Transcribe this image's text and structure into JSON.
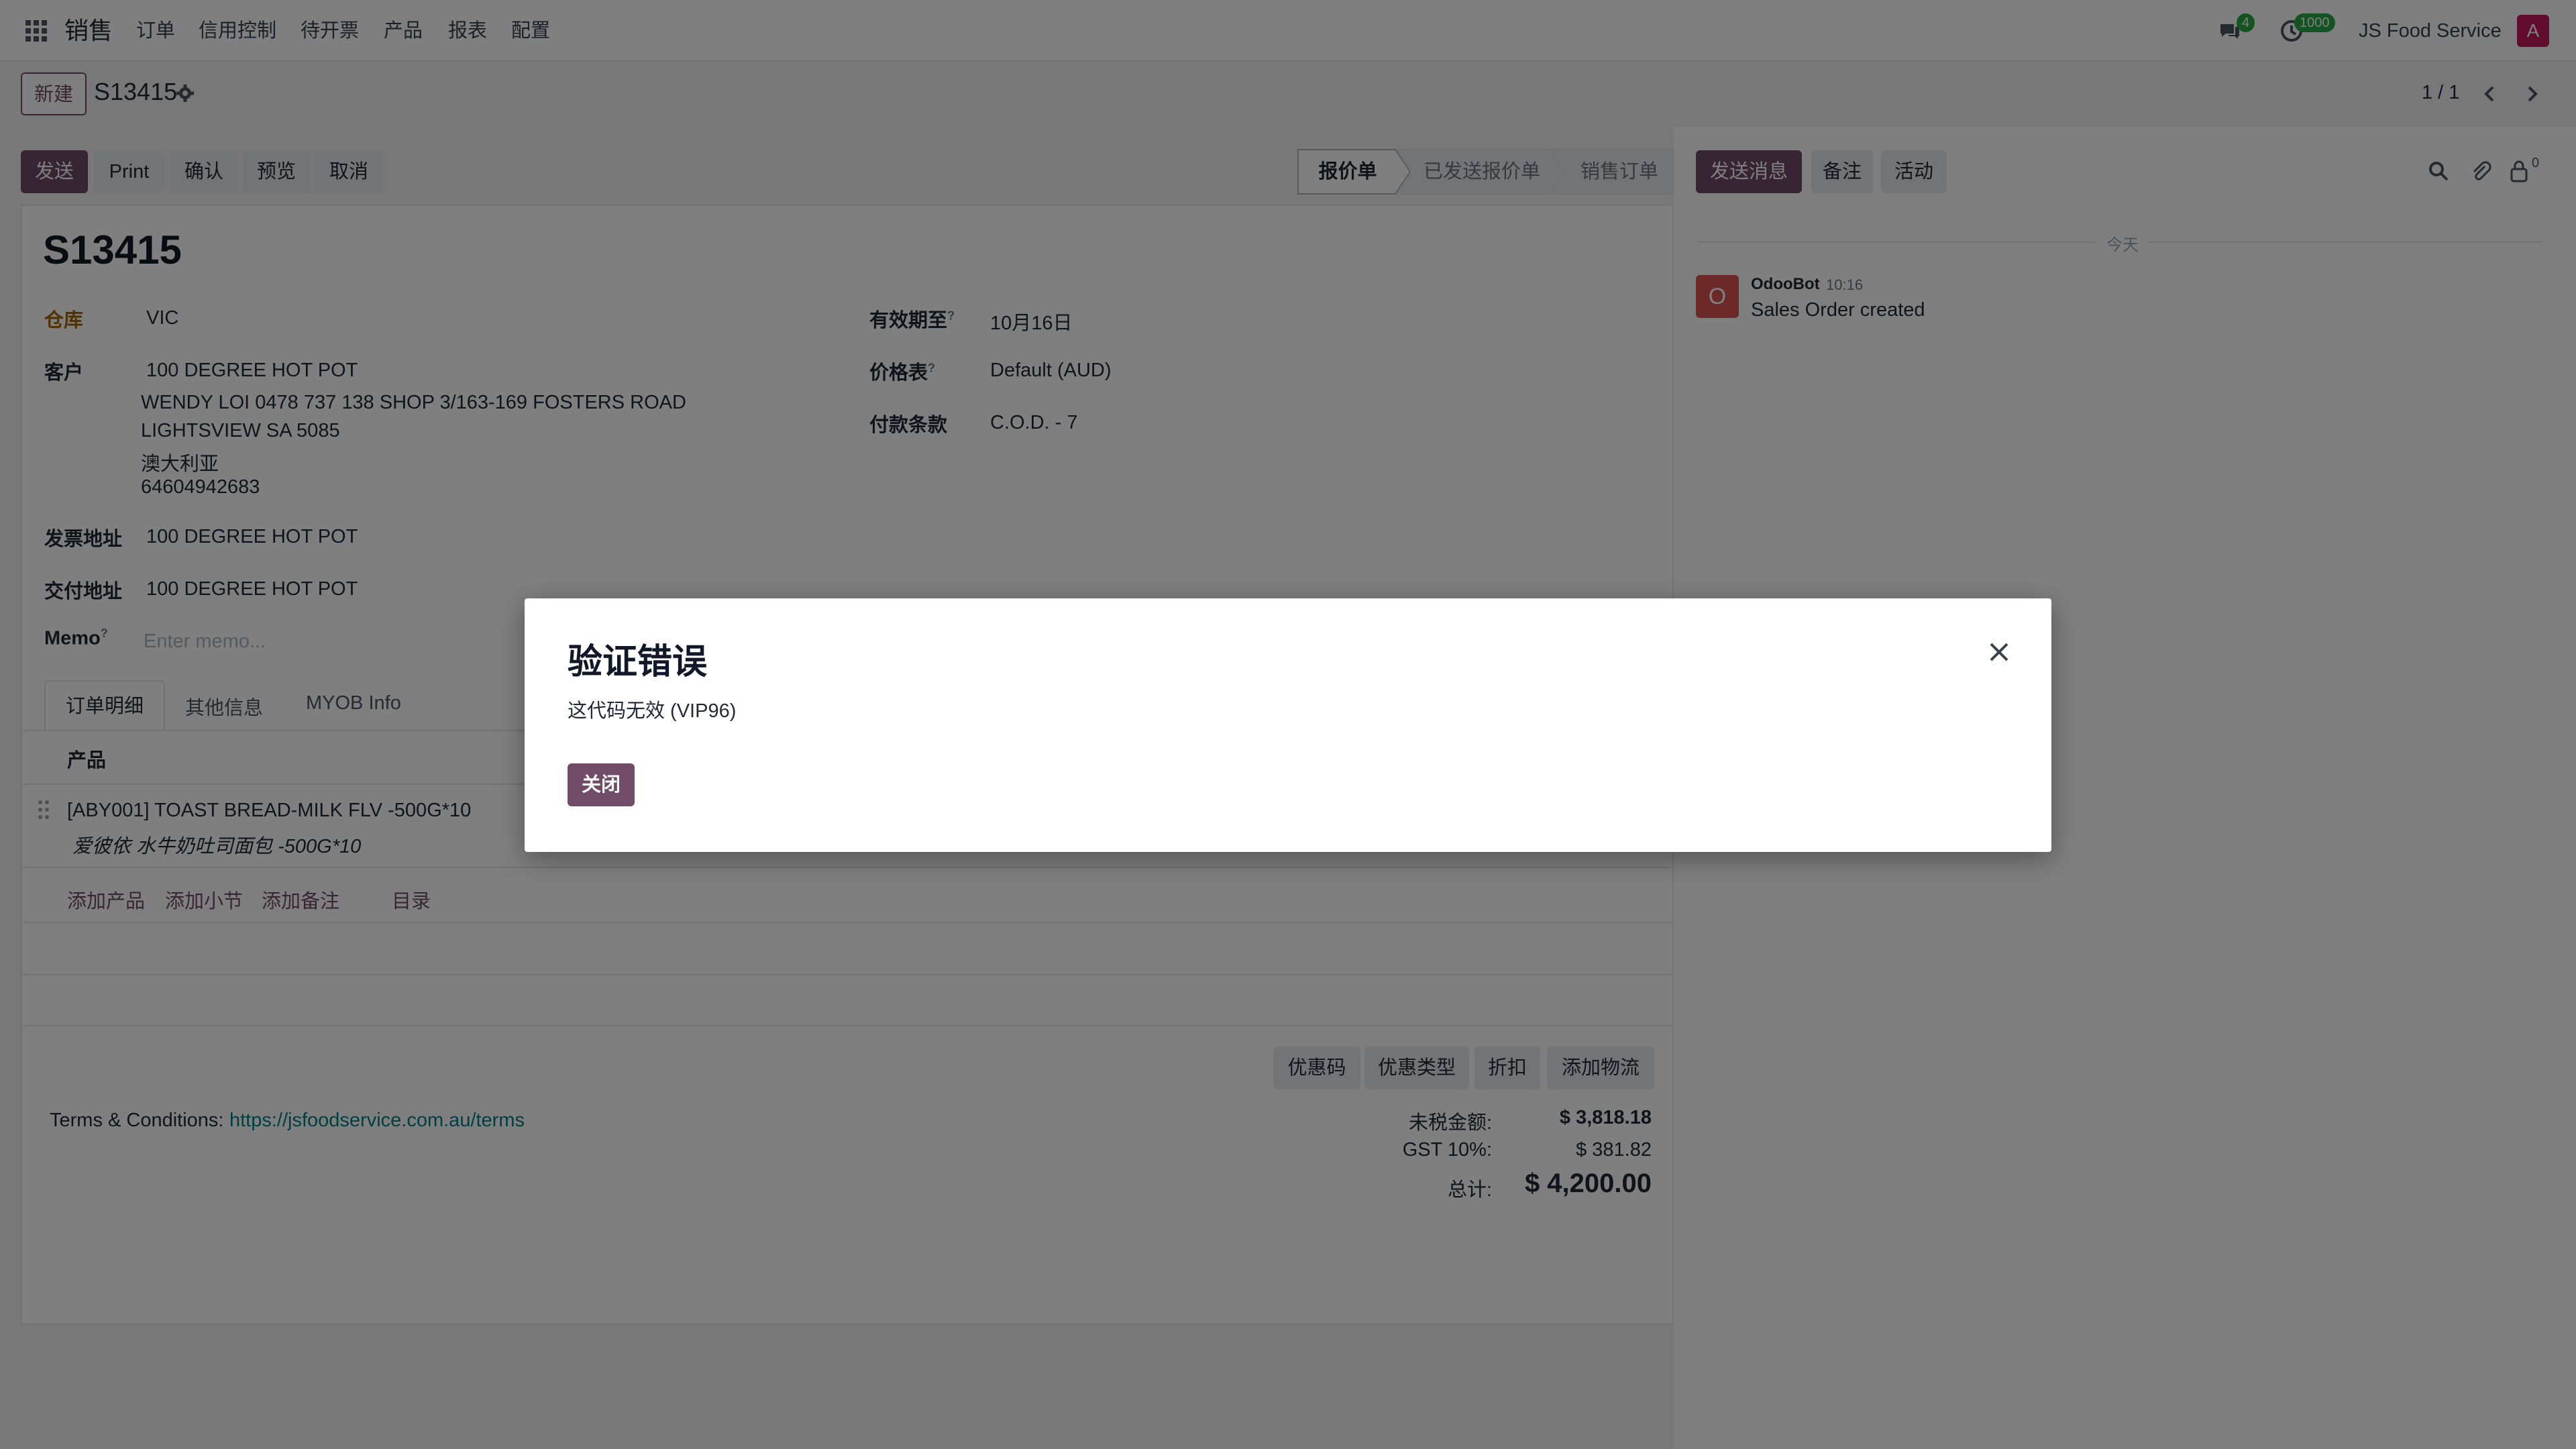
{
  "navbar": {
    "app_name": "销售",
    "menus": [
      "订单",
      "信用控制",
      "待开票",
      "产品",
      "报表",
      "配置"
    ],
    "messages_count": "4",
    "activities_count": "1000",
    "company": "JS Food Service",
    "avatar_letter": "A"
  },
  "control_panel": {
    "new_button": "新建",
    "record_title": "S13415",
    "pager": "1 / 1"
  },
  "actions": {
    "send": "发送",
    "print": "Print",
    "confirm": "确认",
    "preview": "预览",
    "cancel": "取消"
  },
  "statusbar": {
    "stages": [
      "报价单",
      "已发送报价单",
      "销售订单"
    ],
    "active_index": 0
  },
  "chatter": {
    "send_message": "发送消息",
    "log_note": "备注",
    "activity": "活动",
    "follower_count": "0",
    "date_separator": "今天",
    "messages": [
      {
        "author": "OdooBot",
        "time": "10:16",
        "body": "Sales Order created",
        "avatar_letter": "O"
      }
    ]
  },
  "form": {
    "title": "S13415",
    "warehouse_label": "仓库",
    "warehouse": "VIC",
    "customer_label": "客户",
    "customer": "100 DEGREE HOT POT",
    "customer_address": [
      "WENDY LOI 0478 737 138 SHOP 3/163-169 FOSTERS ROAD",
      "LIGHTSVIEW SA 5085",
      "澳大利亚",
      "64604942683"
    ],
    "invoice_address_label": "发票地址",
    "invoice_address": "100 DEGREE HOT POT",
    "delivery_address_label": "交付地址",
    "delivery_address": "100 DEGREE HOT POT",
    "memo_label": "Memo",
    "memo_placeholder": "Enter memo...",
    "validity_label": "有效期至",
    "validity": "10月16日",
    "pricelist_label": "价格表",
    "pricelist": "Default (AUD)",
    "payment_terms_label": "付款条款",
    "payment_terms": "C.O.D. - 7",
    "help_mark": "?"
  },
  "tabs": [
    "订单明细",
    "其他信息",
    "MYOB Info"
  ],
  "order_lines": {
    "column_product": "产品",
    "lines": [
      {
        "name": "[ABY001] TOAST BREAD-MILK FLV -500G*10",
        "description": "爱彼依 水牛奶吐司面包 -500G*10"
      }
    ],
    "add_product": "添加产品",
    "add_section": "添加小节",
    "add_note": "添加备注",
    "catalog": "目录"
  },
  "footer_buttons": {
    "coupon": "优惠码",
    "promo_type": "优惠类型",
    "discount": "折扣",
    "add_shipping": "添加物流"
  },
  "terms": {
    "label": "Terms & Conditions:",
    "link": "https://jsfoodservice.com.au/terms"
  },
  "totals": {
    "untaxed_label": "未税金额:",
    "untaxed": "$ 3,818.18",
    "gst_label": "GST 10%:",
    "gst": "$ 381.82",
    "total_label": "总计:",
    "total": "$ 4,200.00"
  },
  "dialog": {
    "title": "验证错误",
    "message": "这代码无效 (VIP96)",
    "close_button": "关闭"
  },
  "colors": {
    "primary": "#714b67",
    "link": "#017e84",
    "badge_green": "#28a745"
  }
}
